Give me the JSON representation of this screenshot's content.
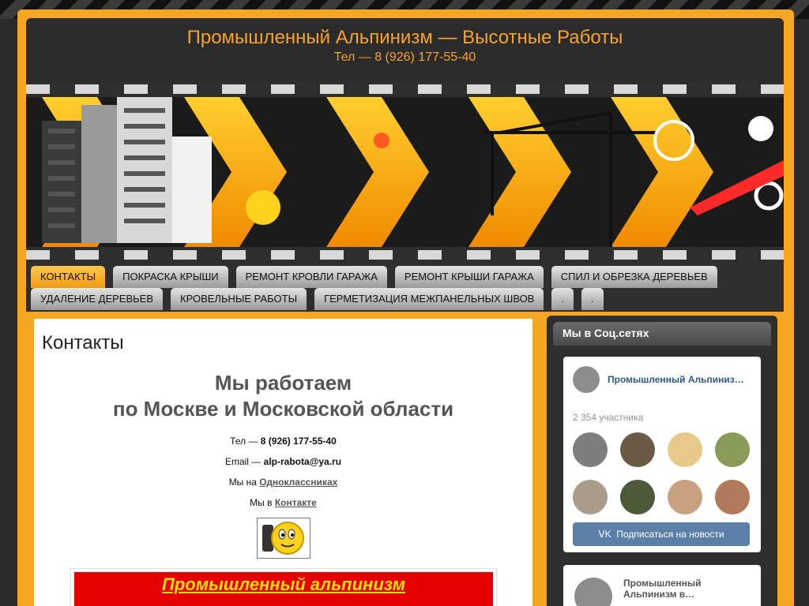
{
  "header": {
    "title": "Промышленный Альпинизм — Высотные Работы",
    "phone": "Тел — 8 (926) 177-55-40"
  },
  "nav": {
    "row1": [
      "КОНТАКТЫ",
      "ПОКРАСКА КРЫШИ",
      "РЕМОНТ КРОВЛИ ГАРАЖА",
      "РЕМОНТ КРЫШИ ГАРАЖА",
      "СПИЛ И ОБРЕЗКА ДЕРЕВЬЕВ"
    ],
    "row2": [
      "УДАЛЕНИЕ ДЕРЕВЬЕВ",
      "КРОВЕЛЬНЫЕ РАБОТЫ",
      "ГЕРМЕТИЗАЦИЯ МЕЖПАНЕЛЬНЫХ ШВОВ",
      ".",
      "."
    ],
    "active": "КОНТАКТЫ"
  },
  "main": {
    "page_title": "Контакты",
    "headline_1": "Мы работаем",
    "headline_2": "по Москве и Московской области",
    "phone_prefix": "Тел — ",
    "phone": "8 (926) 177-55-40",
    "email_prefix": "Email — ",
    "email": "alp-rabota@ya.ru",
    "ok_prefix": "Мы на ",
    "ok_link": "Одноклассниках",
    "vk_prefix": "Мы в ",
    "vk_link": "Контакте",
    "promo_text": "Промышленный альпинизм"
  },
  "sidebar": {
    "title": "Мы в Соц.сетях",
    "vk_widget": {
      "group_name": "Промышленный Альпиниз…",
      "members": "2 354 участника",
      "subscribe_label": "Подписаться на новости"
    },
    "vk_widget2": {
      "group_name": "Промышленный Альпинизм в…"
    }
  },
  "colors": {
    "accent": "#f5a623",
    "title": "#f7a428",
    "vk_blue": "#5b7fa6",
    "promo_red": "#e50000",
    "promo_yellow": "#ffe000"
  }
}
